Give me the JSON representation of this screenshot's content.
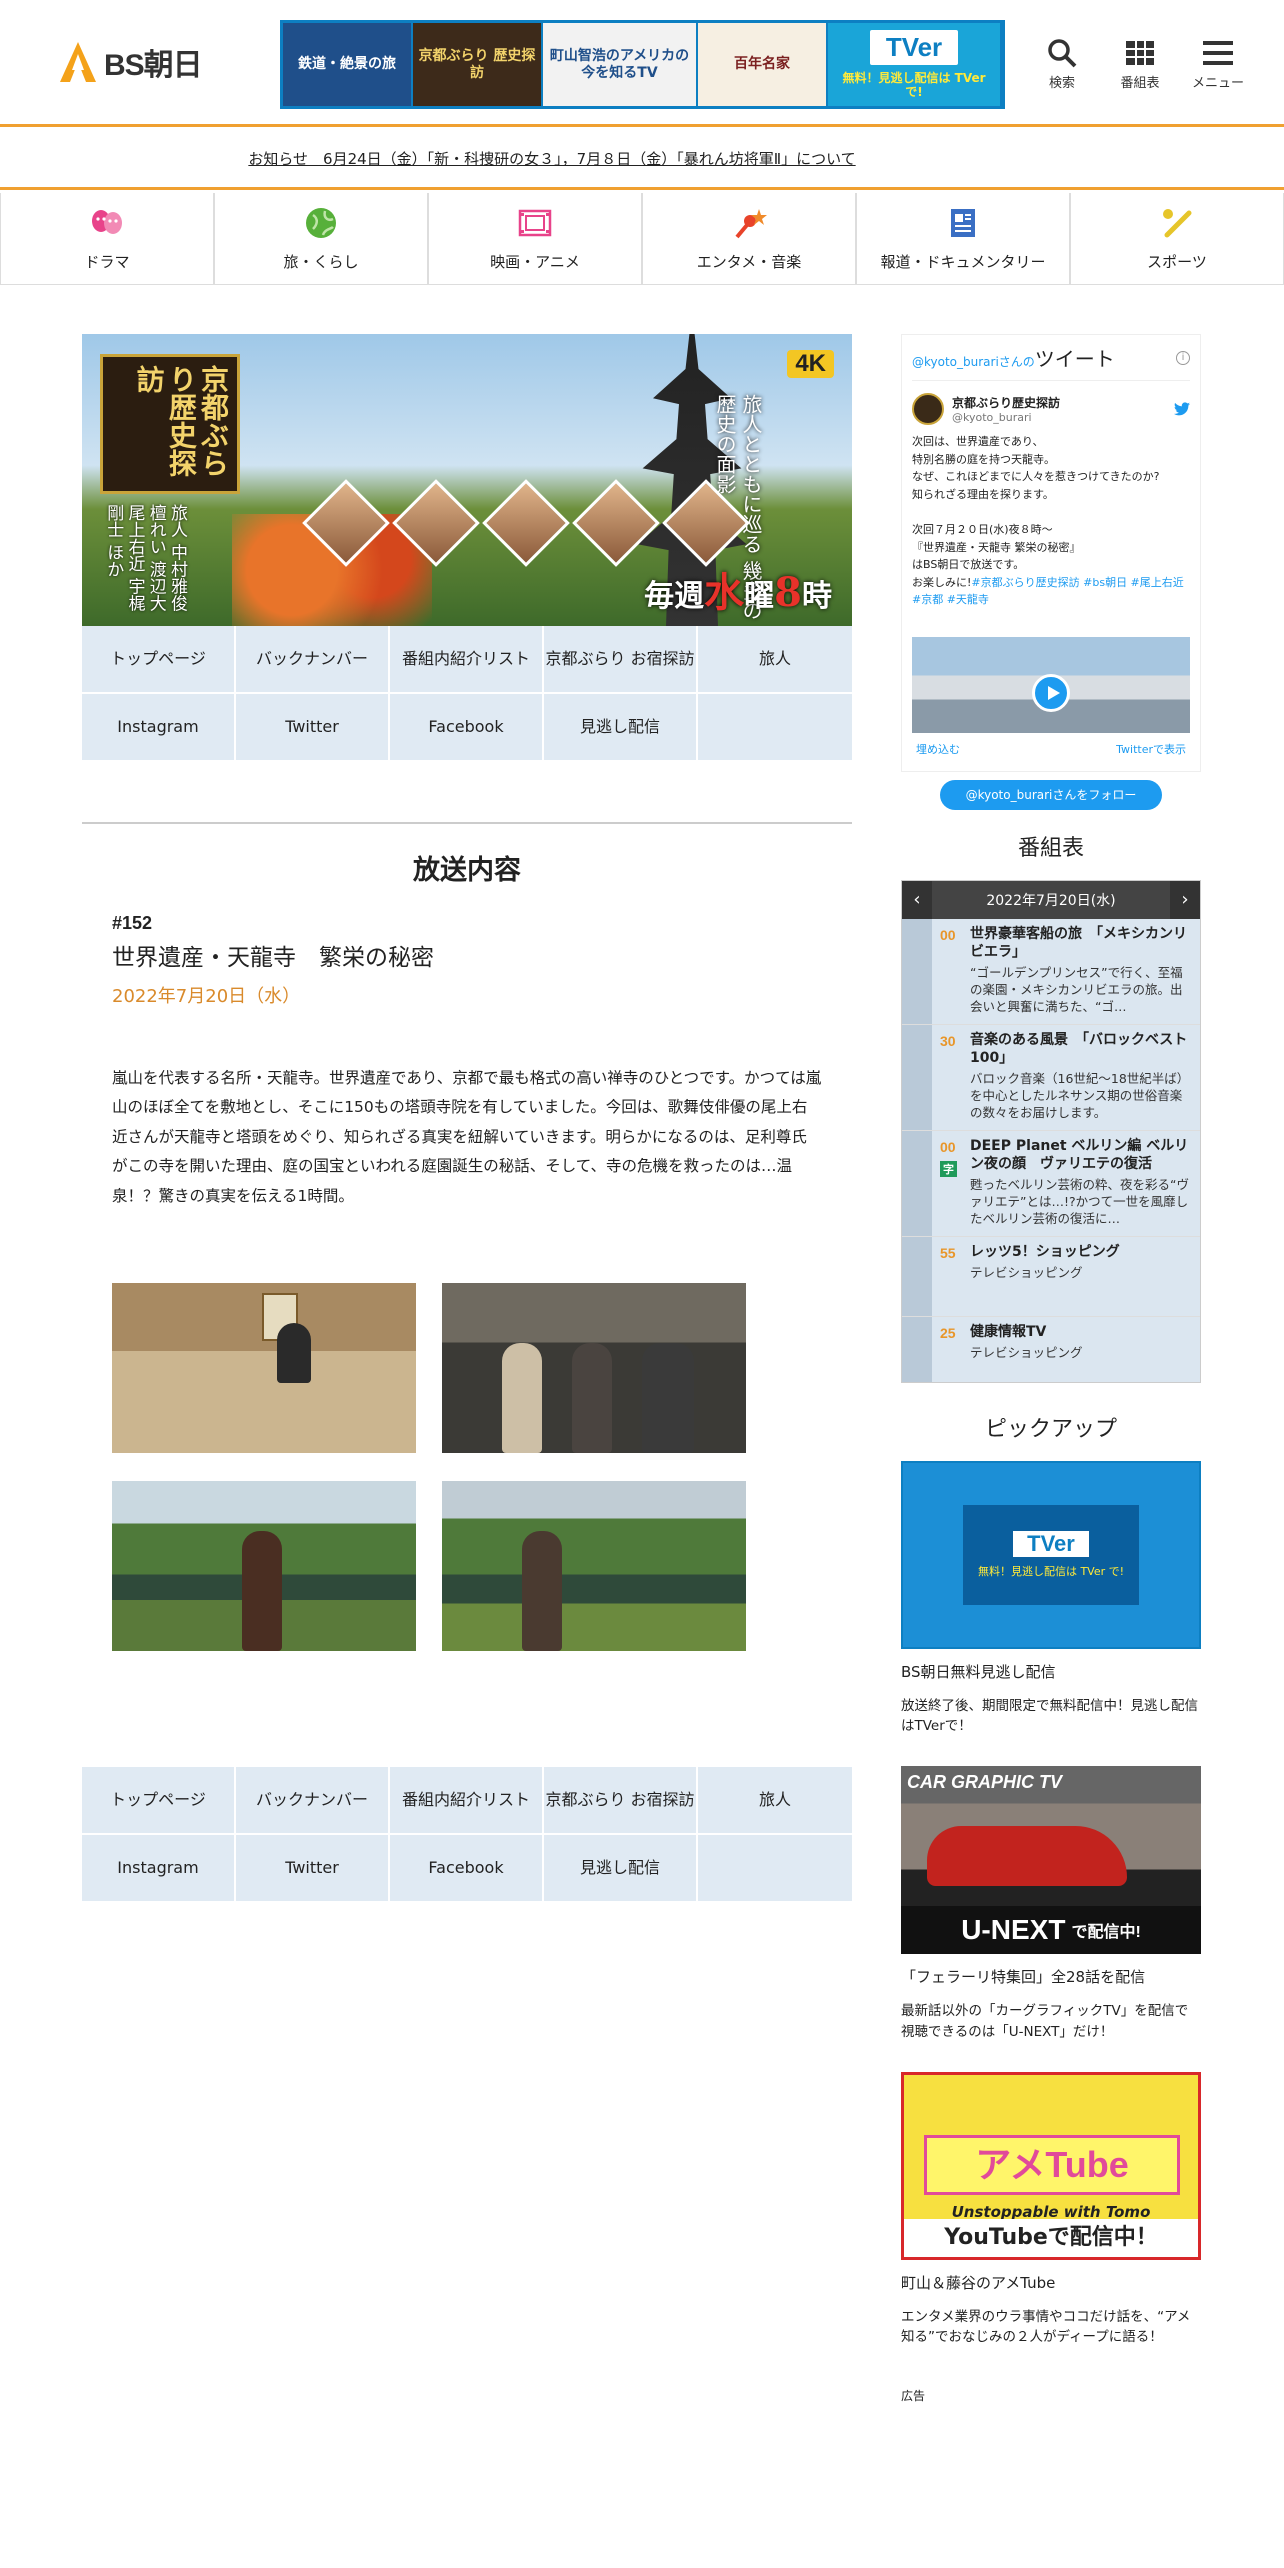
{
  "header": {
    "logo_text": "BS朝日",
    "banner": {
      "seg1": "鉄道・絶景の旅",
      "seg2": "京都ぶらり 歴史探訪",
      "seg3": "町山智浩のアメリカの今を知るTV",
      "seg4": "百年名家",
      "tver_logo": "TVer",
      "tver_note": "無料！見逃し配信は TVer で!"
    },
    "icons": {
      "search": "検索",
      "schedule": "番組表",
      "menu": "メニュー"
    }
  },
  "notice": "お知らせ　6月24日（金）「新・科捜研の女３」，7月８日（金）「暴れん坊将軍Ⅱ」について",
  "categories": [
    "ドラマ",
    "旅・くらし",
    "映画・アニメ",
    "エンタメ・音楽",
    "報道・ドキュメンタリー",
    "スポーツ"
  ],
  "hero": {
    "title": "京都ぶらり歴史探訪",
    "badge": "4K",
    "tagline": "旅人とともに巡る 幾多の歴史の面影",
    "cast": "旅人 中村雅俊 檀れい 渡辺大 尾上右近 宇梶剛士 ほか",
    "time_prefix": "毎週",
    "time_day": "水",
    "time_mid": "曜",
    "time_hour": "8",
    "time_suffix": "時"
  },
  "prog_nav": [
    "トップページ",
    "バックナンバー",
    "番組内紹介リスト",
    "京都ぶらり お宿探訪",
    "旅人",
    "Instagram",
    "Twitter",
    "Facebook",
    "見逃し配信",
    ""
  ],
  "section_title": "放送内容",
  "episode": {
    "number": "#152",
    "title": "世界遺産・天龍寺　繁栄の秘密",
    "date": "2022年7月20日（水）",
    "description": "嵐山を代表する名所・天龍寺。世界遺産であり、京都で最も格式の高い禅寺のひとつです。かつては嵐山のほぼ全てを敷地とし、そこに150もの塔頭寺院を有していました。今回は、歌舞伎俳優の尾上右近さんが天龍寺と塔頭をめぐり、知られざる真実を紐解いていきます。明らかになるのは、足利尊氏がこの寺を開いた理由、庭の国宝といわれる庭園誕生の秘話、そして、寺の危機を救ったのは…温泉！？驚きの真実を伝える1時間。"
  },
  "twitter": {
    "head_handle": "@kyoto_burariさんの",
    "head_label": "ツイート",
    "info": "i",
    "account_name": "京都ぶらり歴史探訪",
    "account_handle": "@kyoto_burari",
    "body": "次回は、世界遺産であり、\n特別名勝の庭を持つ天龍寺。\nなぜ、これほどまでに人々を惹きつけてきたのか?\n知られざる理由を探ります。\n\n次回７月２０日(水)夜８時〜\n『世界遺産・天龍寺 繁栄の秘密』\nはBS朝日で放送です。\nお楽しみに!",
    "hashtags": "#京都ぶらり歴史探訪 #bs朝日 #尾上右近 #京都 #天龍寺",
    "embed": "埋め込む",
    "view": "Twitterで表示",
    "follow": "@kyoto_burariさんをフォロー"
  },
  "epg": {
    "title": "番組表",
    "date": "2022年7月20日(水)",
    "prev": "‹",
    "next": "›",
    "items": [
      {
        "min": "00",
        "title": "世界豪華客船の旅　「メキシカンリビエラ」",
        "desc": "“ゴールデンプリンセス”で行く、至福の楽園・メキシカンリビエラの旅。出会いと興奮に満ちた、“ゴ…",
        "badge": ""
      },
      {
        "min": "30",
        "title": "音楽のある風景　「バロックベスト100」",
        "desc": "バロック音楽（16世紀～18世紀半ば）を中心としたルネサンス期の世俗音楽の数々をお届けします。",
        "badge": ""
      },
      {
        "min": "00",
        "title": "DEEP Planet ベルリン編 ベルリン夜の顔　ヴァリエテの復活",
        "desc": "甦ったベルリン芸術の粋、夜を彩る“ヴァリエテ”とは…!?かつて一世を風靡したベルリン芸術の復活に…",
        "badge": "字"
      },
      {
        "min": "55",
        "title": "レッツ5！ショッピング",
        "desc": "テレビショッピング",
        "badge": ""
      },
      {
        "min": "25",
        "title": "健康情報TV",
        "desc": "テレビショッピング",
        "badge": ""
      }
    ]
  },
  "pickup": {
    "title": "ピックアップ",
    "items": [
      {
        "tv": "TVer",
        "note": "無料！見逃し配信は TVer で!",
        "title": "BS朝日無料見逃し配信",
        "desc": "放送終了後、期間限定で無料配信中！見逃し配信はTVerで！"
      },
      {
        "cg": "CAR GRAPHIC TV",
        "unext": "U-NEXT",
        "unext_suffix": "で配信中!",
        "title": "「フェラーリ特集回」全28話を配信",
        "desc": "最新話以外の「カーグラフィックTV」を配信で視聴できるのは「U-NEXT」だけ！"
      },
      {
        "ame": "アメTube",
        "sub": "Unstoppable with Tomo",
        "yt": "YouTubeで配信中！",
        "title": "町山＆藤谷のアメTube",
        "desc": "エンタメ業界のウラ事情やココだけ話を、“アメ知る”でおなじみの２人がディープに語る！"
      }
    ]
  },
  "ad_label": "広告"
}
